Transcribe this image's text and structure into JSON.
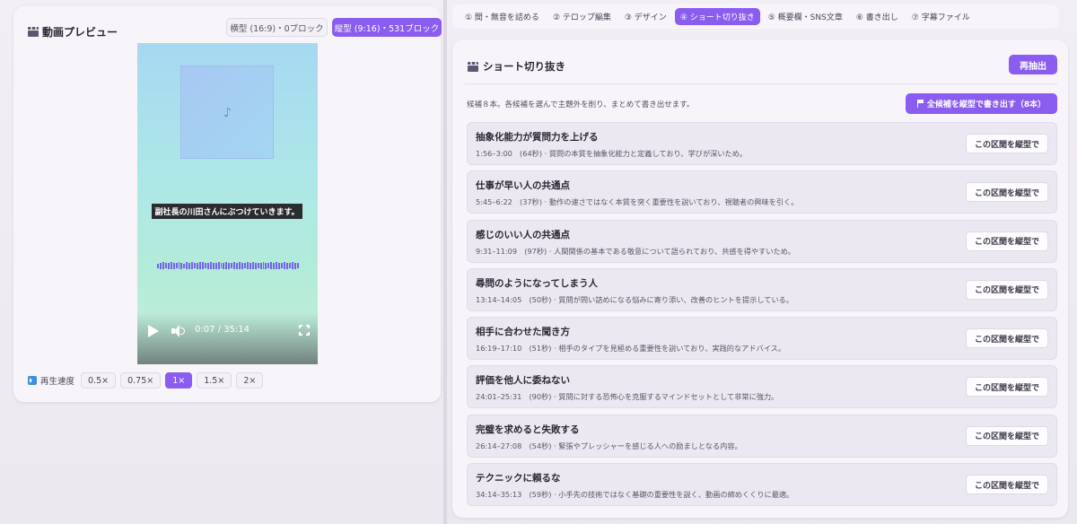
{
  "preview": {
    "title": "動画プレビュー",
    "mode_landscape": "横型 (16:9)・0ブロック",
    "mode_portrait": "縦型 (9:16)・531ブロック",
    "caption": "副社長の川田さんにぶつけていきます。",
    "time": "0:07 / 35:14",
    "progress_fraction": 0.003,
    "speed_label": "再生速度",
    "speeds": [
      "0.5×",
      "0.75×",
      "1×",
      "1.5×",
      "2×"
    ],
    "speed_selected": "1×"
  },
  "tabs": [
    "① 間・無音を詰める",
    "② テロップ編集",
    "③ デザイン",
    "④ ショート切り抜き",
    "⑤ 概要欄・SNS文章",
    "⑥ 書き出し",
    "⑦ 字幕ファイル"
  ],
  "active_tab": "④ ショート切り抜き",
  "short": {
    "title": "ショート切り抜き",
    "reextract_label": "再抽出",
    "summary": "候補８本。各候補を選んで主題外を削り、まとめて書き出せます。",
    "export_all_label": "全候補を縦型で書き出す（8本）",
    "candidate_button_label": "この区間を縦型で",
    "candidates": [
      {
        "title": "抽象化能力が質問力を上げる",
        "meta": "1:56–3:00　(64秒) · 質問の本質を抽象化能力と定義しており、学びが深いため。"
      },
      {
        "title": "仕事が早い人の共通点",
        "meta": "5:45–6:22　(37秒) · 動作の速さではなく本質を突く重要性を説いており、視聴者の興味を引く。"
      },
      {
        "title": "感じのいい人の共通点",
        "meta": "9:31–11:09　(97秒) · 人間関係の基本である敬意について語られており、共感を得やすいため。"
      },
      {
        "title": "尋問のようになってしまう人",
        "meta": "13:14–14:05　(50秒) · 質問が問い詰めになる悩みに寄り添い、改善のヒントを提示している。"
      },
      {
        "title": "相手に合わせた聞き方",
        "meta": "16:19–17:10　(51秒) · 相手のタイプを見極める重要性を説いており、実践的なアドバイス。"
      },
      {
        "title": "評価を他人に委ねない",
        "meta": "24:01–25:31　(90秒) · 質問に対する恐怖心を克服するマインドセットとして非常に強力。"
      },
      {
        "title": "完璧を求めると失敗する",
        "meta": "26:14–27:08　(54秒) · 緊張やプレッシャーを感じる人への励ましとなる内容。"
      },
      {
        "title": "テクニックに頼るな",
        "meta": "34:14–35:13　(59秒) · 小手先の技術ではなく基礎の重要性を説く、動画の締めくくりに最適。"
      }
    ]
  },
  "colors": {
    "accent": "#8a5cf0",
    "waveform": "#7463e8",
    "caption_bg": "#2b2c30"
  },
  "icons": [
    "clapperboard-icon",
    "music-note-icon",
    "play-icon",
    "volume-icon",
    "fullscreen-icon",
    "playback-speed-icon",
    "flag-icon"
  ]
}
